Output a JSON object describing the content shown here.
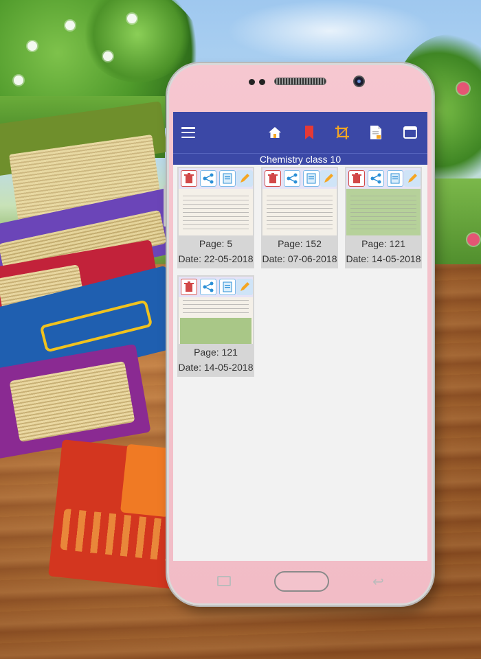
{
  "app": {
    "title": "Chemistry class 10"
  },
  "toolbar": {
    "icons": [
      "menu-icon",
      "home-icon",
      "bookmark-icon",
      "crop-icon",
      "document-icon",
      "window-icon"
    ],
    "accent": "#3b48a6",
    "bookmark_color": "#e53935",
    "crop_color": "#f5a623"
  },
  "bookmarks": [
    {
      "page": "Page: 5",
      "date": "Date: 22-05-2018"
    },
    {
      "page": "Page: 152",
      "date": "Date: 07-06-2018"
    },
    {
      "page": "Page: 121",
      "date": "Date: 14-05-2018"
    },
    {
      "page": "Page: 121",
      "date": "Date: 14-05-2018"
    }
  ],
  "thumbnail_actions": [
    "trash-icon",
    "share-icon",
    "note-icon",
    "edit-icon"
  ],
  "colors": {
    "screen_bg": "#f2f2f2",
    "card_bg": "#d6d6d6",
    "phone_body": "#f4c2cc"
  }
}
